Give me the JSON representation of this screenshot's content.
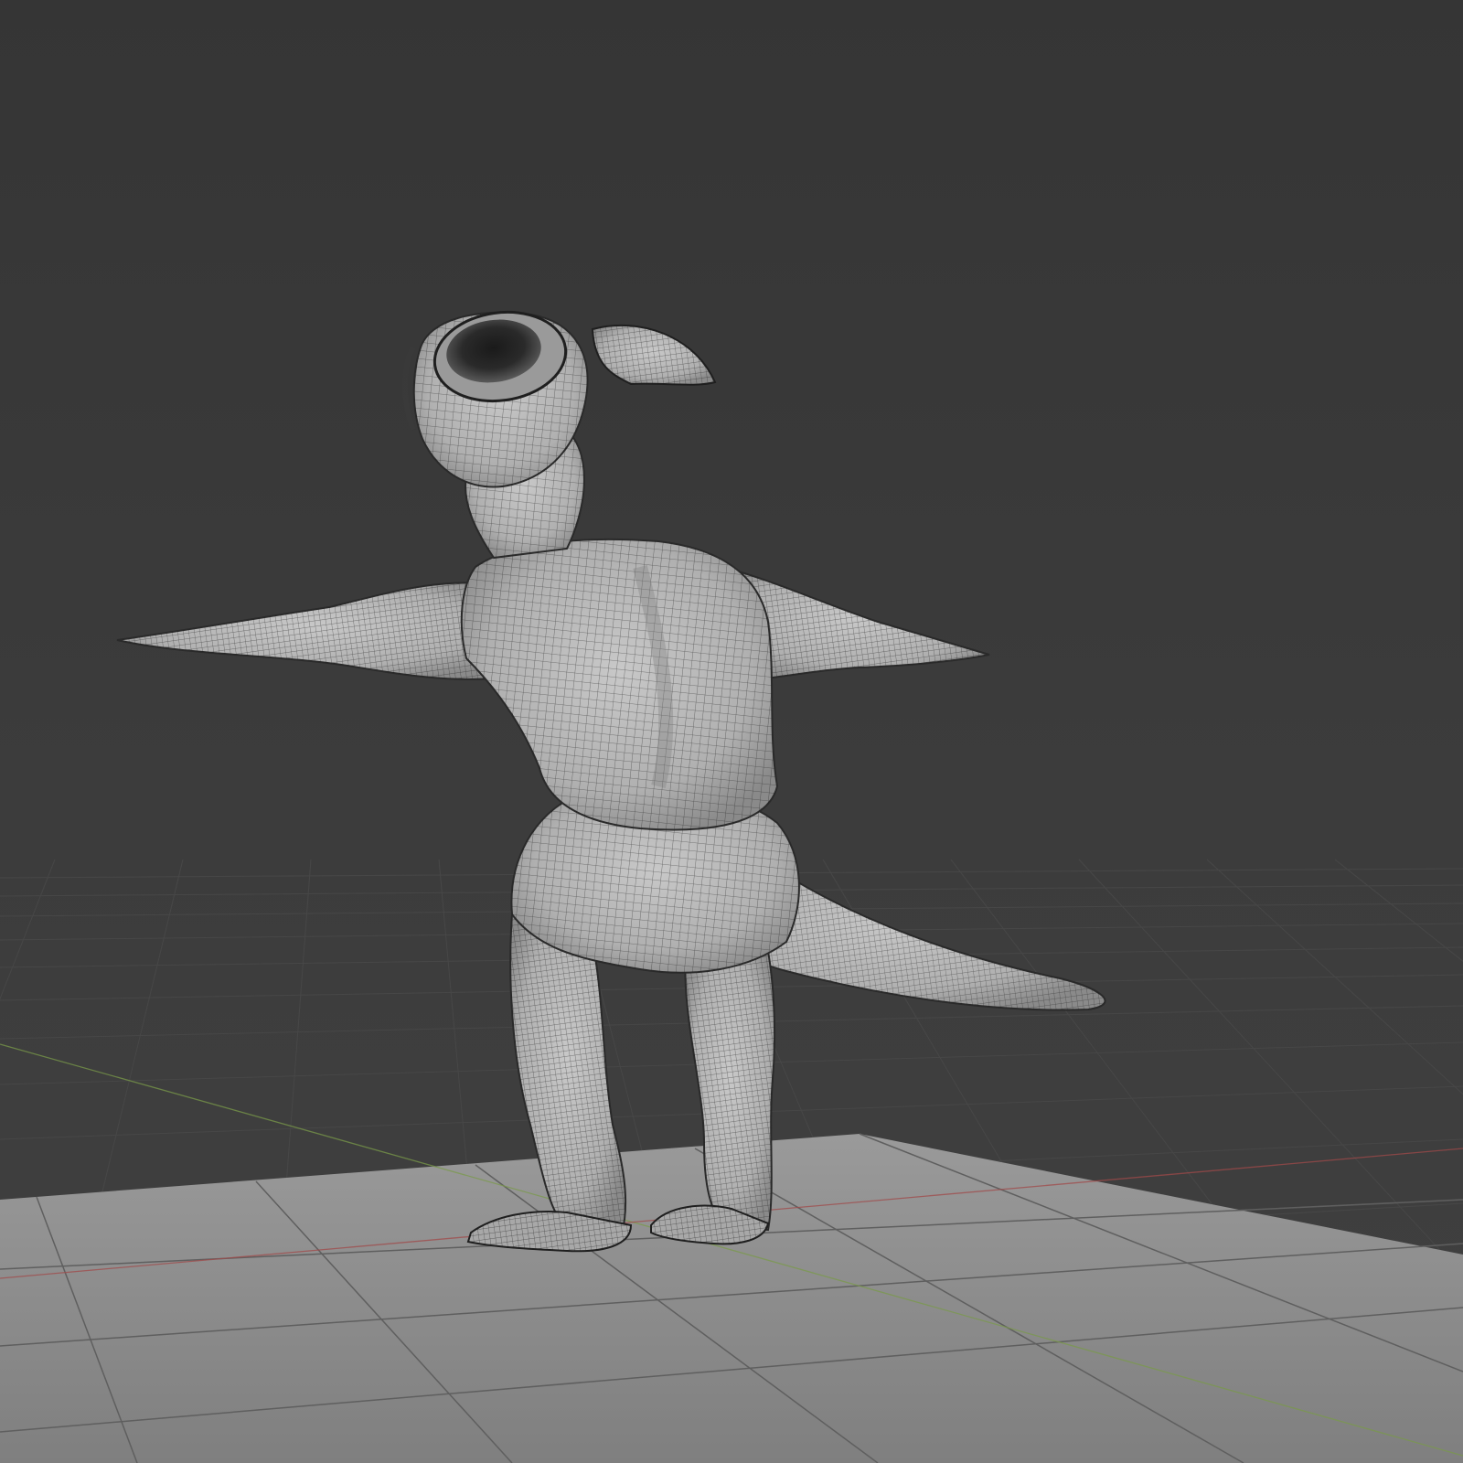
{
  "viewport": {
    "view_mode": "3d-viewport",
    "shading": "solid",
    "overlays": [
      "grid-floor",
      "x-axis-line",
      "y-axis-line",
      "wireframe"
    ],
    "colors": {
      "background_top": "#353535",
      "background_bottom": "#434343",
      "grid_line": "#4a4a4a",
      "floor_plane": "#8f8f8f",
      "floor_grid": "#5e5e5e",
      "x_axis": "#a04a4a",
      "y_axis": "#7a9a4a",
      "mesh_fill": "#b9b9b9",
      "mesh_shadow": "#7e7e7e",
      "wire": "#1a1a1a"
    }
  },
  "objects": [
    {
      "name": "creature-mesh",
      "description_label": "",
      "pose": "t-pose",
      "view": "back-three-quarter",
      "parts": [
        "head",
        "ear-funnels",
        "horn",
        "torso",
        "arms",
        "hips",
        "tail",
        "legs",
        "feet"
      ]
    },
    {
      "name": "floor-plane",
      "description_label": ""
    }
  ]
}
